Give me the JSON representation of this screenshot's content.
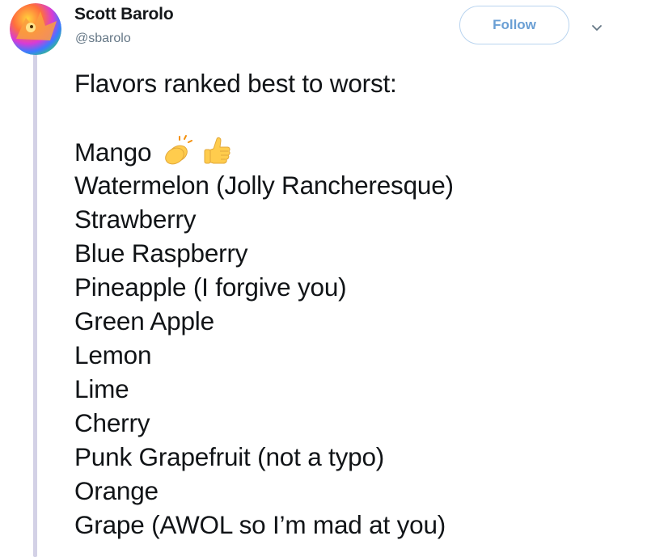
{
  "author": {
    "display_name": "Scott Barolo",
    "handle": "@sbarolo"
  },
  "actions": {
    "follow_label": "Follow",
    "menu_icon": "chevron-down-icon"
  },
  "tweet": {
    "intro": "Flavors ranked best to worst:",
    "items": [
      "Mango",
      "Watermelon (Jolly Rancheresque)",
      "Strawberry",
      "Blue Raspberry",
      "Pineapple (I forgive you)",
      "Green Apple",
      "Lemon",
      "Lime",
      "Cherry",
      "Punk Grapefruit (not a typo)",
      "Orange",
      "Grape (AWOL so I’m mad at you)"
    ],
    "first_item_emojis": [
      "clapping-hands-icon",
      "thumbs-up-icon"
    ]
  },
  "colors": {
    "follow_text": "#6a9fd4",
    "follow_border": "#b9d4ef",
    "handle": "#657786",
    "thread_line": "#d3d1e6"
  }
}
